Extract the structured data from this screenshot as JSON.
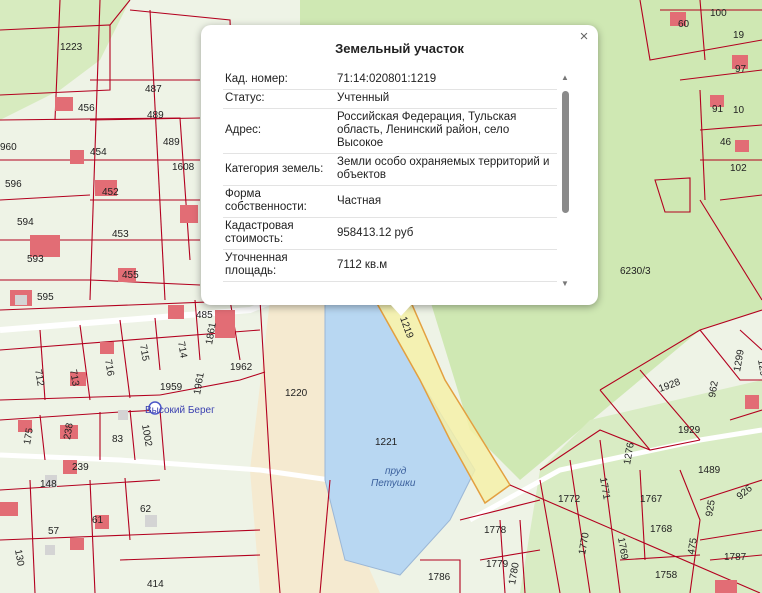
{
  "popup": {
    "title": "Земельный участок",
    "close_icon": "×",
    "rows": [
      {
        "key": "Кад. номер:",
        "value": "71:14:020801:1219"
      },
      {
        "key": "Статус:",
        "value": "Учтенный"
      },
      {
        "key": "Адрес:",
        "value": "Российская Федерация, Тульская область, Ленинский район, село Высокое"
      },
      {
        "key": "Категория земель:",
        "value": "Земли особо охраняемых территорий и объектов"
      },
      {
        "key": "Форма собственности:",
        "value": "Частная"
      },
      {
        "key": "Кадастровая стоимость:",
        "value": "958413.12 руб"
      },
      {
        "key": "Уточненная площадь:",
        "value": "7112 кв.м"
      }
    ],
    "scroll_up_icon": "▲",
    "scroll_down_icon": "▼"
  },
  "map": {
    "pond_label_1": "пруд",
    "pond_label_2": "Петушки",
    "place_label": "Высокий Берег",
    "highlight_label": "1219",
    "parcels": {
      "p1223": "1223",
      "p456": "456",
      "p487": "487",
      "p489a": "489",
      "p489b": "489",
      "p454": "454",
      "p1608": "1608",
      "p452": "452",
      "p596": "596",
      "p594": "594",
      "p453": "453",
      "p593": "593",
      "p455": "455",
      "p595": "595",
      "p485": "485",
      "p714": "714",
      "p1861": "1861",
      "p715": "715",
      "p716": "716",
      "p713": "713",
      "p712": "712",
      "p1959": "1959",
      "p1961": "1961",
      "p1962": "1962",
      "p1002": "1002",
      "p1220": "1220",
      "p1221": "1221",
      "p175": "175",
      "p238": "238",
      "p83": "83",
      "p239": "239",
      "p148": "148",
      "p62": "62",
      "p57": "57",
      "p61": "61",
      "p130": "130",
      "p414": "414",
      "p60": "60",
      "p100": "100",
      "p19": "19",
      "p97": "97",
      "p91": "91",
      "p10": "10",
      "p46": "46",
      "p102": "102",
      "p6230": "6230/3",
      "p1928": "1928",
      "p962": "962",
      "p1929": "1929",
      "p1489": "1489",
      "p1276": "1276",
      "p1771": "1771",
      "p1772": "1772",
      "p1767": "1767",
      "p1768": "1768",
      "p1769": "1769",
      "p1770": "1770",
      "p925": "925",
      "p926": "926",
      "p475": "475",
      "p1778": "1778",
      "p1779": "1779",
      "p1780": "1780",
      "p1786": "1786",
      "p1758": "1758",
      "p1787": "1787",
      "p1299": "1299",
      "p129x": "129",
      "p960": "960"
    }
  }
}
